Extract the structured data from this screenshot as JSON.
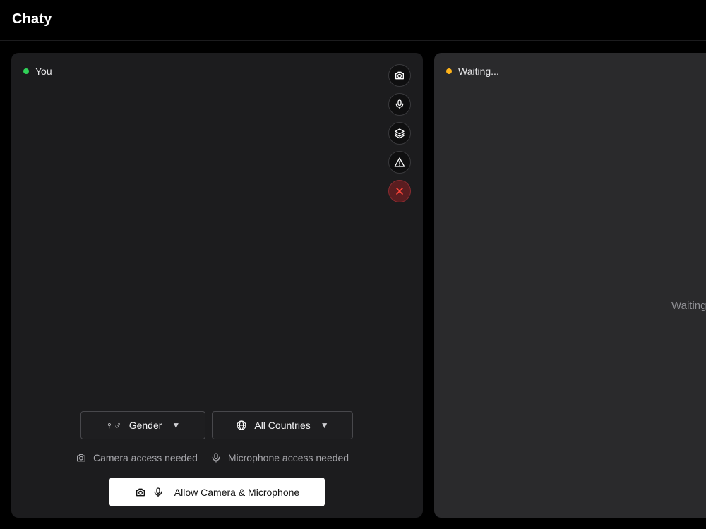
{
  "app": {
    "title": "Chaty"
  },
  "self_panel": {
    "status_label": "You",
    "status_color": "#30d158",
    "controls": [
      {
        "icon": "camera-icon"
      },
      {
        "icon": "microphone-icon"
      },
      {
        "icon": "layers-icon"
      },
      {
        "icon": "warning-icon"
      },
      {
        "icon": "close-icon"
      }
    ],
    "filters": {
      "gender_label": "Gender",
      "gender_symbols": "♀♂",
      "country_label": "All Countries"
    },
    "access": {
      "camera": "Camera access needed",
      "microphone": "Microphone access needed"
    },
    "allow_button": "Allow Camera & Microphone"
  },
  "peer_panel": {
    "status_label": "Waiting...",
    "status_color": "#ffb31a",
    "center_text": "Waiting"
  },
  "colors": {
    "end_call": "#ff453a"
  }
}
